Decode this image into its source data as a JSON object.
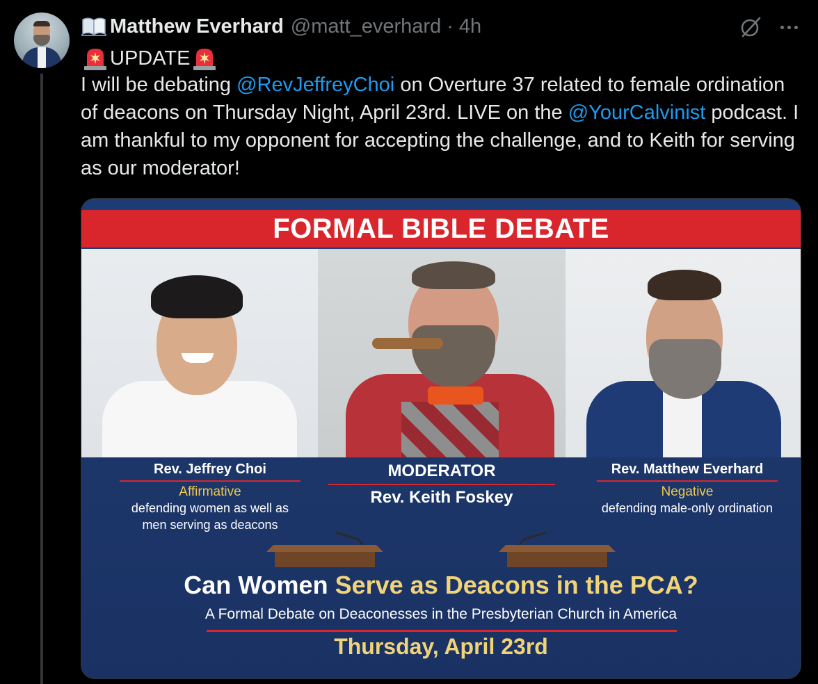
{
  "tweet": {
    "author_name": "Matthew Everhard",
    "handle": "@matt_everhard",
    "separator": "·",
    "time": "4h",
    "update_label": "UPDATE",
    "text_parts": {
      "p1": "I will be debating ",
      "mention1": "@RevJeffreyChoi",
      "p2": " on Overture 37 related to female ordination of deacons on Thursday Night, April 23rd. LIVE on the ",
      "mention2": "@YourCalvinist",
      "p3": " podcast. I am thankful to my opponent for accepting the challenge, and to Keith for serving as our moderator!"
    }
  },
  "icons": {
    "author_badge": "open-book-icon",
    "update_prefix": "police-light-icon",
    "update_suffix": "police-light-icon",
    "grok": "grok-icon",
    "more": "more-horizontal-icon"
  },
  "colors": {
    "background": "#000000",
    "text": "#e7e9ea",
    "muted": "#71767b",
    "link": "#1d9bf0",
    "banner_red": "#d9262d",
    "poster_blue": "#1d376a",
    "gold": "#f2d478"
  },
  "poster": {
    "banner": "FORMAL BIBLE DEBATE",
    "left": {
      "name": "Rev. Jeffrey Choi",
      "role": "Affirmative",
      "desc_line1": "defending women as well as",
      "desc_line2": "men serving as deacons"
    },
    "middle": {
      "label": "MODERATOR",
      "name": "Rev. Keith Foskey"
    },
    "right": {
      "name": "Rev. Matthew Everhard",
      "role": "Negative",
      "desc": "defending male-only ordination"
    },
    "question_white": "Can Women ",
    "question_gold": "Serve as Deacons in the PCA?",
    "subtitle": "A Formal Debate on Deaconesses in the Presbyterian Church in America",
    "date": "Thursday, April 23rd"
  }
}
